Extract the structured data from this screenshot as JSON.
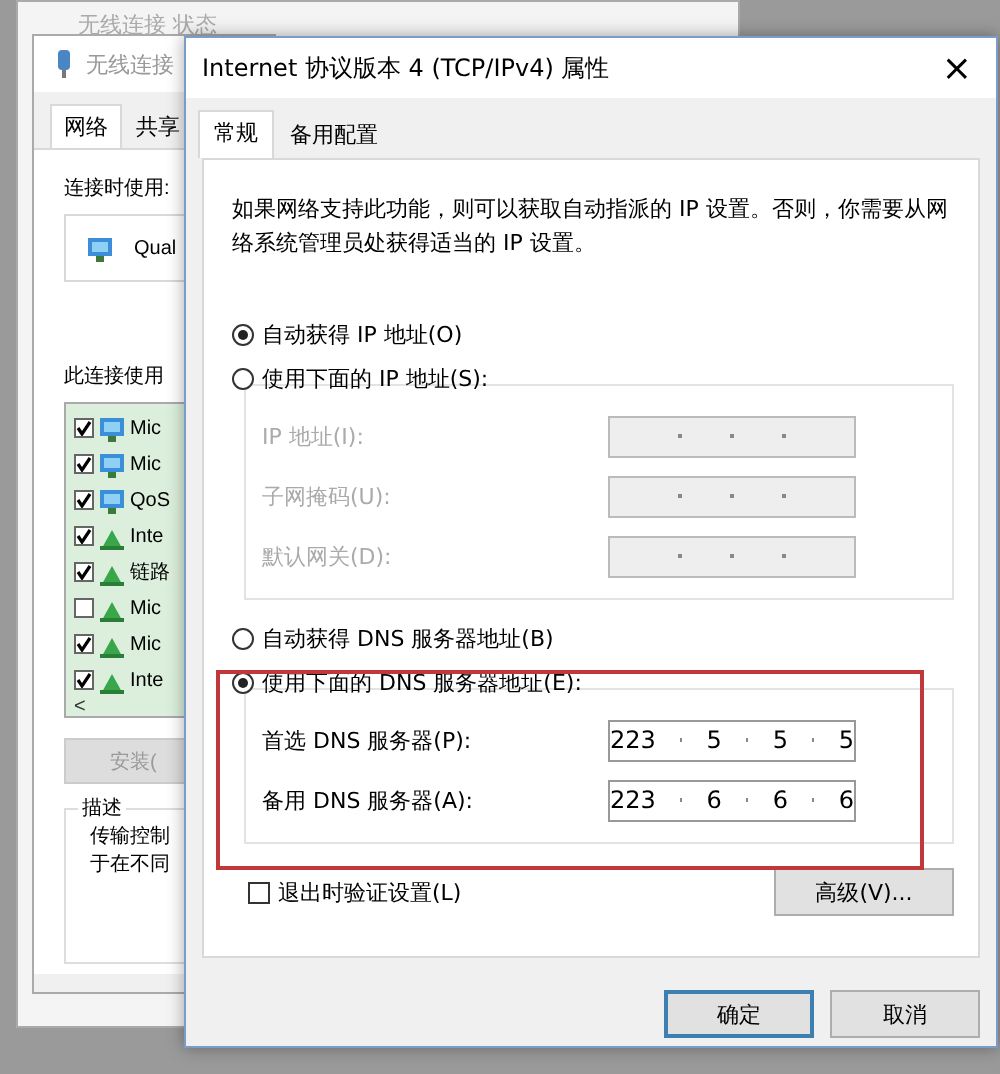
{
  "status_window": {
    "title": "无线连接 状态"
  },
  "adapter_window": {
    "title": "无线连接",
    "tabs": [
      {
        "label": "网络",
        "selected": true
      },
      {
        "label": "共享",
        "selected": false
      }
    ],
    "connect_using_label": "连接时使用:",
    "adapter_name": "Qual",
    "items_label": "此连接使用",
    "items": [
      {
        "label": "Mic",
        "checked": true,
        "kind": "client"
      },
      {
        "label": "Mic",
        "checked": true,
        "kind": "client"
      },
      {
        "label": "QoS",
        "checked": true,
        "kind": "client"
      },
      {
        "label": "Inte",
        "checked": true,
        "kind": "protocol"
      },
      {
        "label": "链路",
        "checked": true,
        "kind": "protocol"
      },
      {
        "label": "Mic",
        "checked": false,
        "kind": "protocol"
      },
      {
        "label": "Mic",
        "checked": true,
        "kind": "protocol"
      },
      {
        "label": "Inte",
        "checked": true,
        "kind": "protocol"
      }
    ],
    "scroll_left": "<",
    "install_button": {
      "label": "安装(",
      "disabled": true
    },
    "description": {
      "title": "描述",
      "lines": [
        "传输控制",
        "于在不同"
      ]
    }
  },
  "dialog": {
    "title": "Internet 协议版本 4 (TCP/IPv4) 属性",
    "close": "×",
    "tabs": [
      {
        "label": "常规",
        "selected": true
      },
      {
        "label": "备用配置",
        "selected": false
      }
    ],
    "intro": "如果网络支持此功能，则可以获取自动指派的 IP 设置。否则，你需要从网络系统管理员处获得适当的 IP 设置。",
    "ip_mode": [
      {
        "label": "自动获得 IP 地址(O)",
        "selected": true
      },
      {
        "label": "使用下面的 IP 地址(S):",
        "selected": false
      }
    ],
    "ip_fields": [
      {
        "label": "IP 地址(I):",
        "disabled": true
      },
      {
        "label": "子网掩码(U):",
        "disabled": true
      },
      {
        "label": "默认网关(D):",
        "disabled": true
      }
    ],
    "dns_mode": [
      {
        "label": "自动获得 DNS 服务器地址(B)",
        "selected": false
      },
      {
        "label": "使用下面的 DNS 服务器地址(E):",
        "selected": true
      }
    ],
    "dns_fields": [
      {
        "label": "首选 DNS 服务器(P):",
        "disabled": false,
        "octets": [
          "223",
          "5",
          "5",
          "5"
        ]
      },
      {
        "label": "备用 DNS 服务器(A):",
        "disabled": false,
        "octets": [
          "223",
          "6",
          "6",
          "6"
        ]
      }
    ],
    "validate": {
      "label": "退出时验证设置(L)",
      "checked": false
    },
    "advanced_button": "高级(V)...",
    "buttons": [
      {
        "label": "确定",
        "default": true
      },
      {
        "label": "取消",
        "default": false
      }
    ]
  }
}
